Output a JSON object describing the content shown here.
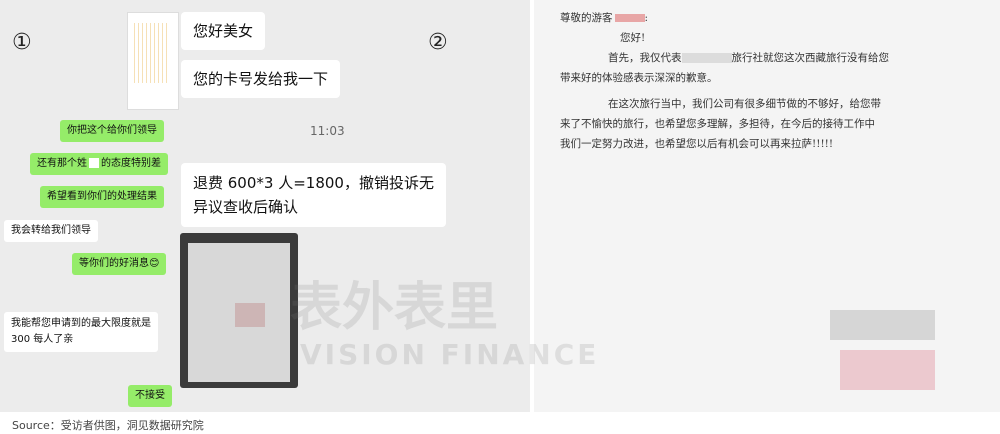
{
  "markers": {
    "left": "①",
    "right": "②"
  },
  "chat": {
    "time": "11:03",
    "top_bubbles": [
      "您好美女",
      "您的卡号发给我一下"
    ],
    "green_left": [
      "你把这个给你们领导",
      "还有那个姓",
      "的态度特别差",
      "希望看到你们的处理结果"
    ],
    "white_left": [
      "我会转给我们领导"
    ],
    "green_wait": "等你们的好消息😊",
    "white_limit": [
      "我能帮您申请到的最大限度就是",
      "300 每人了亲"
    ],
    "refund_lines": [
      "退费 600*3 人=1800，撤销投诉无",
      "异议查收后确认"
    ],
    "final_green": "不接受"
  },
  "letter": {
    "greeting": "尊敬的游客",
    "hello": "您好!",
    "p1a": "首先，我仅代表",
    "p1b": "旅行社就您这次西藏旅行没有给您",
    "p1c": "带来好的体验感表示深深的歉意。",
    "p2a": "在这次旅行当中，我们公司有很多细节做的不够好，给您带",
    "p2b": "来了不愉快的旅行，也希望您多理解，多担待，在今后的接待工作中",
    "p2c": "我们一定努力改进，也希望您以后有机会可以再来拉萨!!!!!"
  },
  "watermark": {
    "cn": "表外表里",
    "en": "VISION FINANCE"
  },
  "source": "Source：受访者供图，洞见数据研究院"
}
